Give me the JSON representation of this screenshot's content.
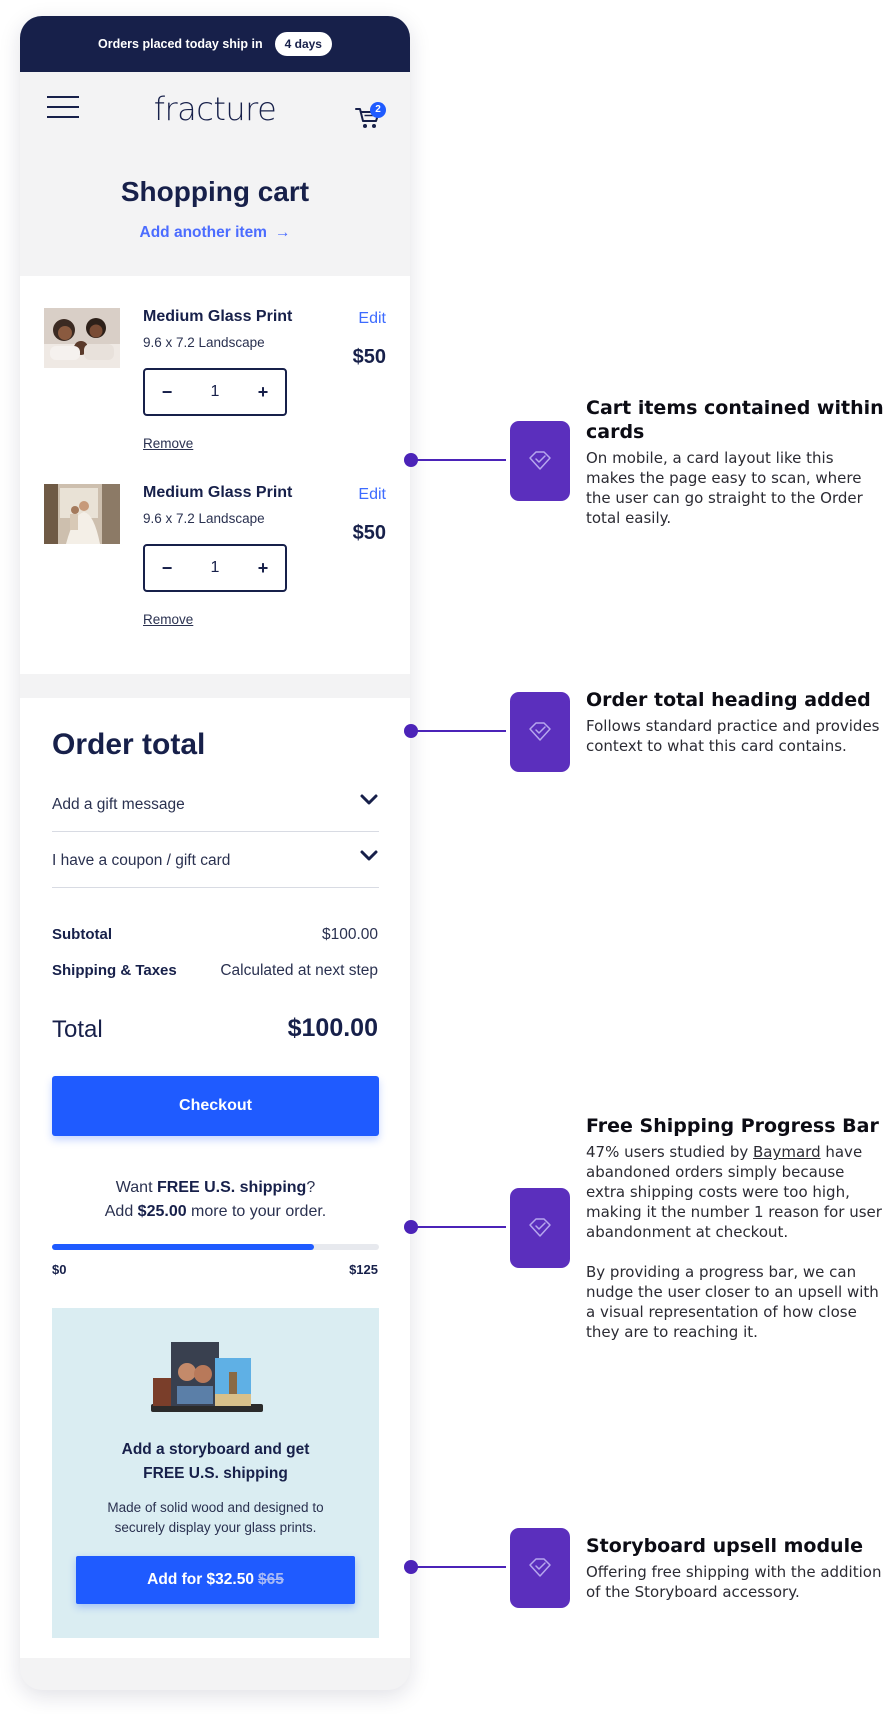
{
  "banner": {
    "text": "Orders placed today ship in",
    "pill": "4 days"
  },
  "header": {
    "logo": "fracture",
    "menu_icon": "hamburger-menu-icon",
    "cart_icon": "shopping-cart-icon",
    "cart_count": "2"
  },
  "page": {
    "title": "Shopping cart",
    "add_link": "Add another item",
    "add_link_icon": "arrow-right-icon"
  },
  "cart": {
    "items": [
      {
        "name": "Medium Glass Print",
        "size": "9.6 x 7.2 Landscape",
        "edit": "Edit",
        "price": "$50",
        "qty": "1",
        "minus": "−",
        "plus": "+",
        "remove": "Remove",
        "image": "family-photo-thumbnail"
      },
      {
        "name": "Medium Glass Print",
        "size": "9.6 x 7.2 Landscape",
        "edit": "Edit",
        "price": "$50",
        "qty": "1",
        "minus": "−",
        "plus": "+",
        "remove": "Remove",
        "image": "wedding-photo-thumbnail"
      }
    ]
  },
  "order": {
    "heading": "Order total",
    "accordions": [
      {
        "label": "Add a gift message"
      },
      {
        "label": "I have a coupon / gift card"
      }
    ],
    "subtotal_label": "Subtotal",
    "subtotal_value": "$100.00",
    "shipping_label": "Shipping & Taxes",
    "shipping_value": "Calculated at next step",
    "total_label": "Total",
    "total_value": "$100.00",
    "checkout": "Checkout"
  },
  "free_shipping": {
    "line1_pre": "Want ",
    "line1_bold": "FREE U.S. shipping",
    "line1_post": "?",
    "line2_pre": "Add ",
    "line2_bold": "$25.00",
    "line2_post": " more to your order.",
    "progress": 0.8,
    "min_label": "$0",
    "max_label": "$125"
  },
  "upsell": {
    "title_line1": "Add a storyboard and get",
    "title_line2": "FREE U.S. shipping",
    "desc_line1": "Made of solid wood and designed to",
    "desc_line2": "securely display your glass prints.",
    "button_label": "Add for $32.50",
    "button_old_price": "$65"
  },
  "annotations": [
    {
      "title": "Cart items contained within cards",
      "text": [
        "On mobile, a card layout like this makes the page easy to scan, where the user can go straight to the Order total easily."
      ]
    },
    {
      "title": "Order total heading added",
      "text": [
        "Follows standard practice and provides context to what this card contains."
      ]
    },
    {
      "title": "Free Shipping Progress Bar",
      "text_pre": "47% users studied by ",
      "text_link": "Baymard",
      "text_post": " have abandoned orders simply because extra shipping costs were too high, making it the number 1 reason for user abandonment at checkout.",
      "text2": "By providing a progress bar, we can nudge the user closer to an upsell with a visual representation of how close they are to reaching it."
    },
    {
      "title": "Storyboard upsell module",
      "text": [
        "Offering free shipping with the addition of the Storyboard accessory."
      ]
    }
  ],
  "colors": {
    "navy": "#17204a",
    "accent_blue": "#1f5bff",
    "annotation_purple": "#5b2fbd",
    "upsell_bg": "#daedf2"
  }
}
